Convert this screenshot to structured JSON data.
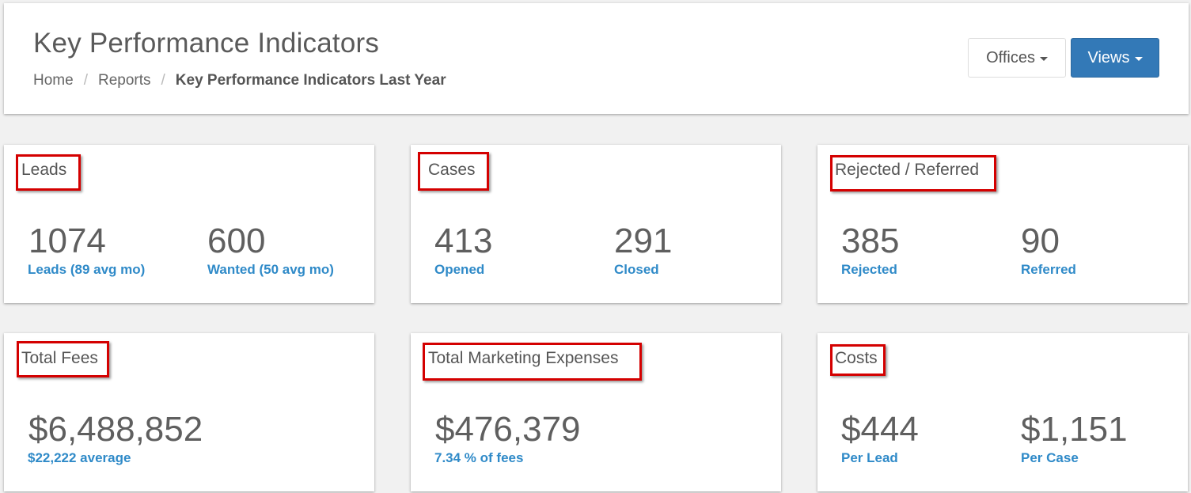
{
  "header": {
    "title": "Key Performance Indicators",
    "breadcrumb": {
      "home": "Home",
      "separator": "/",
      "reports": "Reports",
      "current": "Key Performance Indicators Last Year"
    },
    "offices_button": "Offices",
    "views_button": "Views"
  },
  "cards": {
    "leads": {
      "title": "Leads",
      "stat1": {
        "value": "1074",
        "label": "Leads (89 avg mo)"
      },
      "stat2": {
        "value": "600",
        "label": "Wanted (50 avg mo)"
      }
    },
    "cases": {
      "title": "Cases",
      "stat1": {
        "value": "413",
        "label": "Opened"
      },
      "stat2": {
        "value": "291",
        "label": "Closed"
      }
    },
    "rejected": {
      "title": "Rejected / Referred",
      "stat1": {
        "value": "385",
        "label": "Rejected"
      },
      "stat2": {
        "value": "90",
        "label": "Referred"
      }
    },
    "fees": {
      "title": "Total Fees",
      "stat1": {
        "value": "$6,488,852",
        "label": "$22,222 average"
      }
    },
    "marketing": {
      "title": "Total Marketing Expenses",
      "stat1": {
        "value": "$476,379",
        "label": "7.34 % of fees"
      }
    },
    "costs": {
      "title": "Costs",
      "stat1": {
        "value": "$444",
        "label": "Per Lead"
      },
      "stat2": {
        "value": "$1,151",
        "label": "Per Case"
      }
    }
  },
  "colors": {
    "accent": "#3379b7",
    "link": "#2f8ac8",
    "highlight_box": "#d40000",
    "background": "#f1f1f1"
  }
}
